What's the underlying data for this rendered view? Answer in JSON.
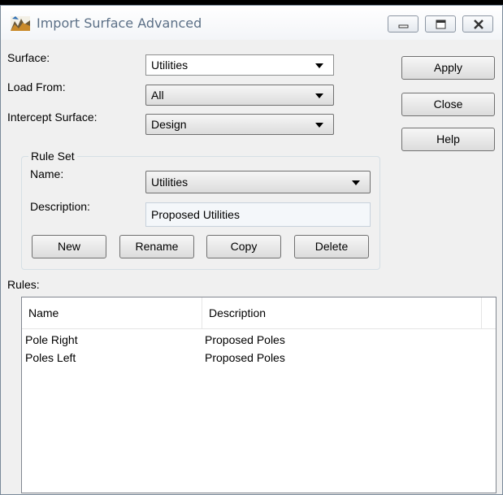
{
  "window": {
    "title": "Import Surface Advanced"
  },
  "form": {
    "surface": {
      "label": "Surface:",
      "value": "Utilities"
    },
    "load_from": {
      "label": "Load From:",
      "value": "All"
    },
    "intercept_surface": {
      "label": "Intercept Surface:",
      "value": "Design"
    }
  },
  "side_buttons": {
    "apply": "Apply",
    "close": "Close",
    "help": "Help"
  },
  "rule_set": {
    "title": "Rule Set",
    "name_label": "Name:",
    "name_value": "Utilities",
    "description_label": "Description:",
    "description_value": "Proposed Utilities",
    "buttons": {
      "new": "New",
      "rename": "Rename",
      "copy": "Copy",
      "delete": "Delete"
    }
  },
  "rules": {
    "label": "Rules:",
    "columns": [
      "Name",
      "Description"
    ],
    "rows": [
      [
        "Pole Right",
        "Proposed Poles"
      ],
      [
        "Poles Left",
        "Proposed Poles"
      ]
    ]
  }
}
